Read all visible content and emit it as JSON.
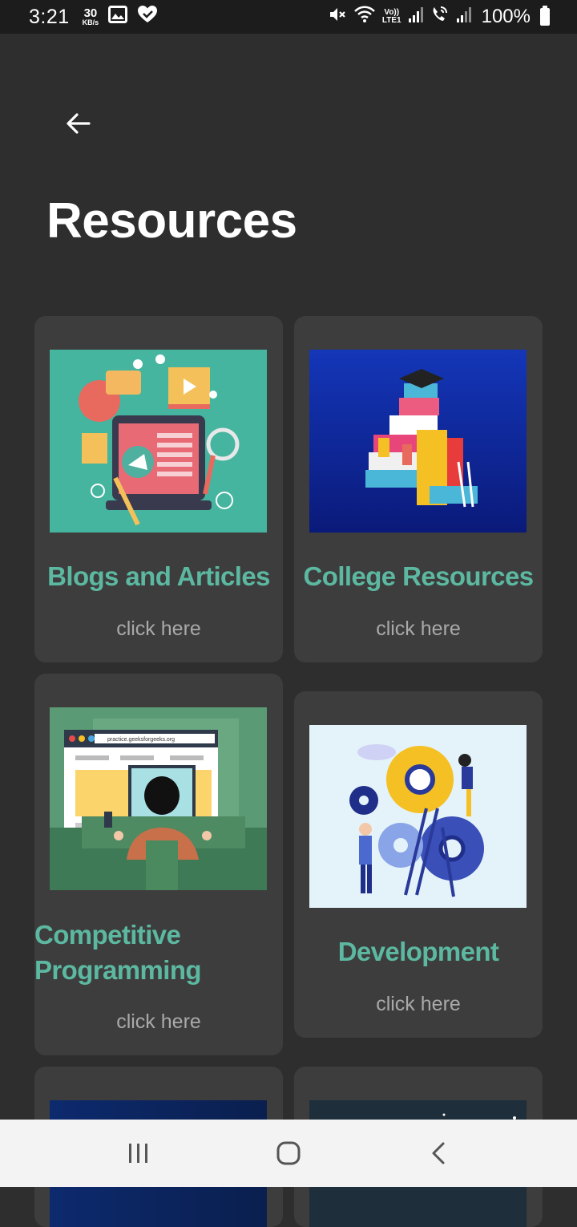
{
  "status_bar": {
    "time": "3:21",
    "net_speed_value": "30",
    "net_speed_unit": "KB/s",
    "volte_label": "Vo))",
    "lte_label": "LTE1",
    "battery_percent": "100%",
    "icons": [
      "gallery-icon",
      "heart-notification-icon",
      "mute-icon",
      "wifi-icon",
      "signal-sim1-icon",
      "wifi-calling-icon",
      "signal-sim2-icon",
      "battery-icon"
    ]
  },
  "header": {
    "back_icon": "arrow-left-icon",
    "title": "Resources"
  },
  "cards": [
    {
      "title": "Blogs and Articles",
      "link": "click here",
      "image": "blogs-illustration"
    },
    {
      "title": "College Resources",
      "link": "click here",
      "image": "college-books-illustration"
    },
    {
      "title": "Competitive Programming",
      "link": "click here",
      "image": "coder-illustration",
      "image_url_text": "practice.geeksforgeeks.org"
    },
    {
      "title": "Development",
      "link": "click here",
      "image": "gears-illustration"
    },
    {
      "image": "dark-blue-illustration"
    },
    {
      "image": "dark-night-illustration"
    }
  ],
  "nav_bar": {
    "icons": [
      "recent-apps-icon",
      "home-icon",
      "back-icon"
    ]
  },
  "colors": {
    "background": "#2e2e2e",
    "status_bar": "#1c1c1c",
    "card": "#3d3d3d",
    "accent": "#5cb8a0",
    "link": "#a9a9a9",
    "nav_bar": "#f3f3f3"
  }
}
